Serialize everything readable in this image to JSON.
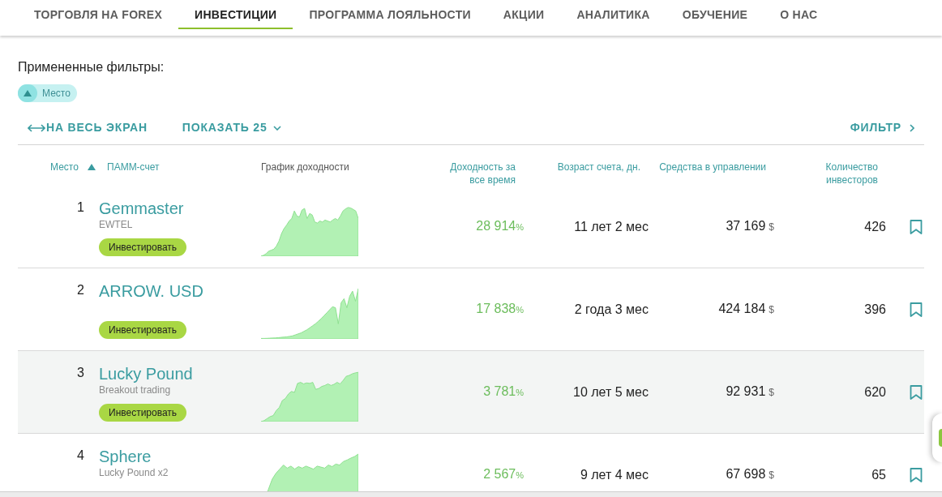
{
  "nav": {
    "items": [
      {
        "label": "ТОРГОВЛЯ НА FOREX",
        "selected": false
      },
      {
        "label": "ИНВЕСТИЦИИ",
        "selected": true
      },
      {
        "label": "ПРОГРАММА ЛОЯЛЬНОСТИ",
        "selected": false
      },
      {
        "label": "АКЦИИ",
        "selected": false
      },
      {
        "label": "АНАЛИТИКА",
        "selected": false
      },
      {
        "label": "ОБУЧЕНИЕ",
        "selected": false
      },
      {
        "label": "О НАС",
        "selected": false
      }
    ]
  },
  "applied_filters": {
    "title": "Примененные фильтры:",
    "chips": [
      {
        "label": "Место",
        "ascending": true
      }
    ]
  },
  "toolbar": {
    "fullscreen": "НА ВЕСЬ ЭКРАН",
    "show": "ПОКАЗАТЬ 25",
    "filter": "ФИЛЬТР"
  },
  "table": {
    "columns": [
      {
        "label": "Место",
        "sortable": true,
        "sorted": true,
        "ascending": true
      },
      {
        "label": "ПАММ-счет",
        "sortable": true,
        "sorted": false
      },
      {
        "label": "График доходности",
        "sortable": false,
        "sorted": false
      },
      {
        "label": "Доходность за все время",
        "sortable": true,
        "sorted": false
      },
      {
        "label": "Возраст счета, дн.",
        "sortable": true,
        "sorted": false
      },
      {
        "label": "Средства в управлении",
        "sortable": true,
        "sorted": false
      },
      {
        "label": "Количество инвесторов",
        "sortable": true,
        "sorted": false
      }
    ],
    "rows": [
      {
        "rank": "1",
        "name": "Gemmaster",
        "subtitle": "EWTEL",
        "button": "Инвестировать",
        "yield": "28 914",
        "yield_unit": "%",
        "age": "11 лет 2 мес",
        "funds": "37 169",
        "funds_unit": "$",
        "investors": "426",
        "hovered": false
      },
      {
        "rank": "2",
        "name": "ARROW. USD",
        "button": "Инвестировать",
        "yield": "17 838",
        "yield_unit": "%",
        "age": "2 года 3 мес",
        "funds": "424 184",
        "funds_unit": "$",
        "investors": "396",
        "hovered": false
      },
      {
        "rank": "3",
        "name": "Lucky Pound",
        "subtitle": "Breakout trading",
        "button": "Инвестировать",
        "yield": "3 781",
        "yield_unit": "%",
        "age": "10 лет 5 мес",
        "funds": "92 931",
        "funds_unit": "$",
        "investors": "620",
        "hovered": true
      },
      {
        "rank": "4",
        "name": "Sphere",
        "subtitle": "Lucky Pound x2",
        "yield": "2 567",
        "yield_unit": "%",
        "age": "9 лет 4 мес",
        "funds": "67 698",
        "funds_unit": "$",
        "investors": "65",
        "hovered": false
      }
    ]
  }
}
